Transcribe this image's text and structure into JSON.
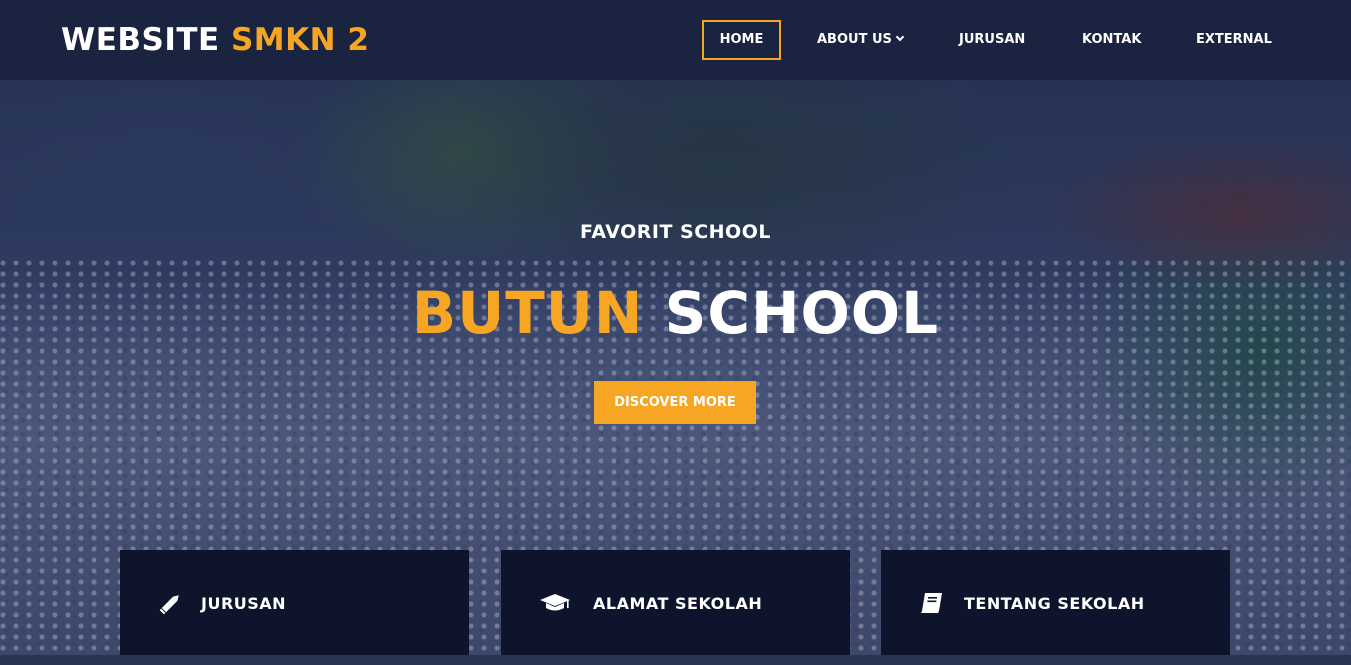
{
  "header": {
    "brand_prefix": "WEBSITE",
    "brand_accent": "SMKN 2",
    "nav": [
      {
        "label": "HOME",
        "active": true
      },
      {
        "label": "ABOUT US",
        "dropdown": true
      },
      {
        "label": "JURUSAN"
      },
      {
        "label": "KONTAK"
      },
      {
        "label": "EXTERNAL"
      }
    ]
  },
  "hero": {
    "subtitle": "FAVORIT SCHOOL",
    "headline_accent": "BUTUN",
    "headline_rest": "SCHOOL",
    "cta_label": "DISCOVER MORE"
  },
  "cards": [
    {
      "title": "JURUSAN",
      "icon": "pencil-icon"
    },
    {
      "title": "ALAMAT SEKOLAH",
      "icon": "graduation-cap-icon"
    },
    {
      "title": "TENTANG SEKOLAH",
      "icon": "book-icon"
    }
  ],
  "colors": {
    "accent": "#f6a623",
    "header_bg": "#1a2340",
    "card_bg": "#0e142b"
  }
}
